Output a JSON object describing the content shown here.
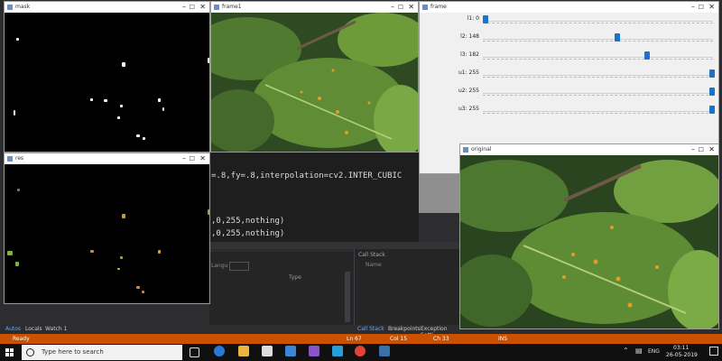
{
  "windows": {
    "mask": {
      "title": "mask"
    },
    "frame1": {
      "title": "frame1"
    },
    "frame": {
      "title": "frame"
    },
    "res": {
      "title": "res"
    },
    "original": {
      "title": "original"
    }
  },
  "trackbars": [
    {
      "label": "l1: 0",
      "value": 0,
      "max": 255
    },
    {
      "label": "l2: 148",
      "value": 148,
      "max": 255
    },
    {
      "label": "l3: 182",
      "value": 182,
      "max": 255
    },
    {
      "label": "u1: 255",
      "value": 255,
      "max": 255
    },
    {
      "label": "u2: 255",
      "value": 255,
      "max": 255
    },
    {
      "label": "u3: 255",
      "value": 255,
      "max": 255
    }
  ],
  "editor": {
    "line1": "=.8,fy=.8,interpolation=cv2.INTER_CUBIC",
    "line2": ",0,255,nothing)",
    "line3": ",0,255,nothing)"
  },
  "autos_panel": {
    "col_type": "Type",
    "lang_label": "Langu"
  },
  "callstack_panel": {
    "title": "Call Stack",
    "col_name": "Name"
  },
  "bottom_tabs_left": [
    "Autos",
    "Locals",
    "Watch 1"
  ],
  "bottom_tabs_right": [
    "Call Stack",
    "Breakpoints",
    "Exception Setti"
  ],
  "status": {
    "ready": "Ready",
    "ln": "Ln 67",
    "col": "Col 15",
    "ch": "Ch 33",
    "ins": "INS"
  },
  "taskbar": {
    "search_placeholder": "Type here to search",
    "time": "03:11",
    "date": "26-05-2019",
    "lang": "ENG"
  }
}
